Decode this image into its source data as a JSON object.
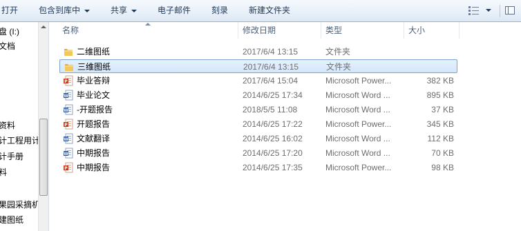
{
  "toolbar": {
    "open": "打开",
    "include_library": "包含到库中",
    "share": "共享",
    "email": "电子邮件",
    "burn": "刻录",
    "new_folder": "新建文件夹"
  },
  "nav": {
    "items": [
      {
        "label": "盘 (I:)"
      },
      {
        "label": "文档"
      },
      {
        "label": "资料"
      },
      {
        "label": "计工程用计"
      },
      {
        "label": "计手册"
      },
      {
        "label": "料"
      },
      {
        "label": "果园采摘机"
      },
      {
        "label": "建图纸"
      }
    ]
  },
  "columns": {
    "name": "名称",
    "date": "修改日期",
    "type": "类型",
    "size": "大小"
  },
  "files": [
    {
      "name": "二维图纸",
      "date": "2017/6/4 13:15",
      "type": "文件夹",
      "size": "",
      "icon": "folder-icon"
    },
    {
      "name": "三维图纸",
      "date": "2017/6/4 13:15",
      "type": "文件夹",
      "size": "",
      "icon": "folder-icon",
      "selected": true
    },
    {
      "name": "毕业答辩",
      "date": "2017/6/4 15:04",
      "type": "Microsoft Power...",
      "size": "382 KB",
      "icon": "powerpoint-icon"
    },
    {
      "name": "毕业论文",
      "date": "2014/6/25 17:34",
      "type": "Microsoft Word ...",
      "size": "895 KB",
      "icon": "word-icon"
    },
    {
      "name": "-开题报告",
      "date": "2018/5/5 11:08",
      "type": "Microsoft Word ...",
      "size": "37 KB",
      "icon": "word-icon"
    },
    {
      "name": "开题报告",
      "date": "2014/6/25 17:22",
      "type": "Microsoft Power...",
      "size": "345 KB",
      "icon": "powerpoint-icon"
    },
    {
      "name": "文献翻译",
      "date": "2014/6/25 16:02",
      "type": "Microsoft Word ...",
      "size": "112 KB",
      "icon": "word-icon"
    },
    {
      "name": "中期报告",
      "date": "2014/6/25 17:20",
      "type": "Microsoft Word ...",
      "size": "70 KB",
      "icon": "word-icon"
    },
    {
      "name": "中期报告",
      "date": "2014/6/25 17:35",
      "type": "Microsoft Power...",
      "size": "98 KB",
      "icon": "powerpoint-icon"
    }
  ],
  "colors": {
    "selection_fill": "#d9e8fb",
    "selection_border": "#7da2ce",
    "folder": "#e8b64a",
    "word": "#2b579a",
    "powerpoint": "#c43e1c"
  }
}
